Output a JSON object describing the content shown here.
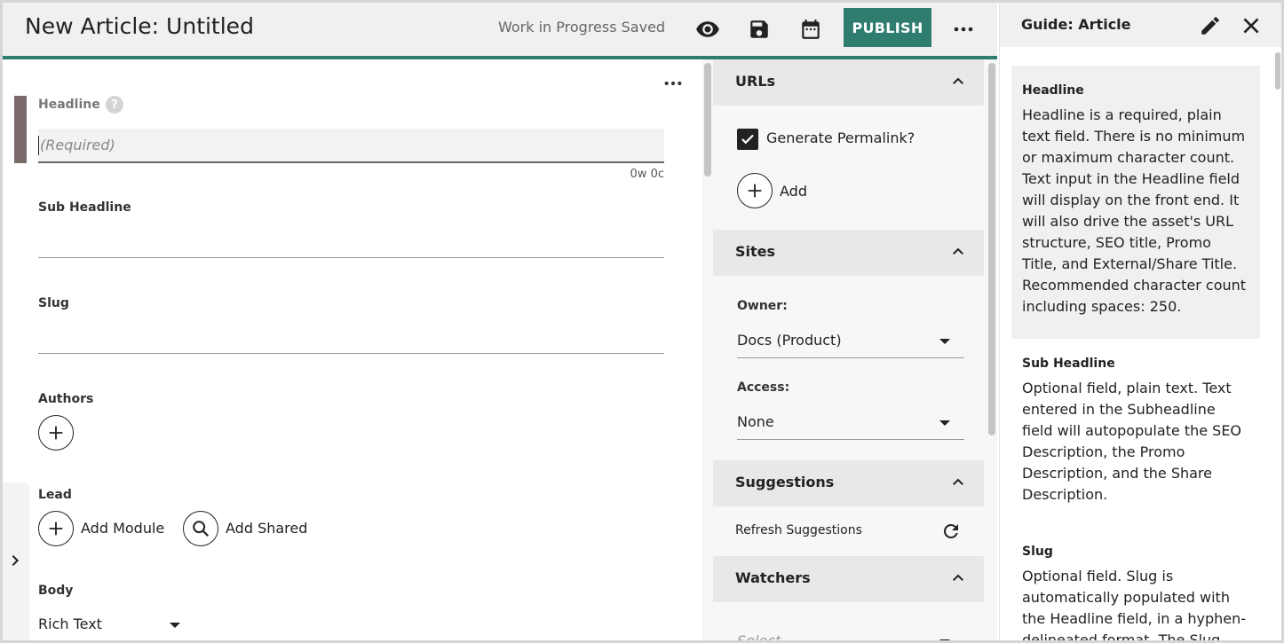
{
  "header": {
    "title": "New Article: Untitled",
    "save_status": "Work in Progress Saved",
    "publish_label": "PUBLISH"
  },
  "editor": {
    "headline": {
      "label": "Headline",
      "help": "?",
      "placeholder": "(Required)",
      "count": "0w 0c"
    },
    "sub_headline": {
      "label": "Sub Headline"
    },
    "slug": {
      "label": "Slug"
    },
    "authors": {
      "label": "Authors"
    },
    "lead": {
      "label": "Lead",
      "add_module_label": "Add Module",
      "add_shared_label": "Add Shared"
    },
    "body": {
      "label": "Body",
      "selected": "Rich Text"
    }
  },
  "panel": {
    "urls": {
      "title": "URLs",
      "generate_permalink_label": "Generate Permalink?",
      "generate_permalink_checked": true,
      "add_label": "Add"
    },
    "sites": {
      "title": "Sites",
      "owner_label": "Owner:",
      "owner_value": "Docs (Product)",
      "access_label": "Access:",
      "access_value": "None"
    },
    "suggestions": {
      "title": "Suggestions",
      "refresh_label": "Refresh Suggestions"
    },
    "watchers": {
      "title": "Watchers",
      "select_placeholder": "Select"
    }
  },
  "guide": {
    "title": "Guide: Article",
    "entries": [
      {
        "heading": "Headline",
        "text": "Headline is a required, plain text field. There is no minimum or maximum character count. Text input in the Headline field will display on the front end. It will also drive the asset's URL structure, SEO title, Promo Title, and External/Share Title. Recommended character count including spaces: 250."
      },
      {
        "heading": "Sub Headline",
        "text": "Optional field, plain text. Text entered in the Subheadline field will autopopulate the SEO Description, the Promo Description, and the Share Description."
      },
      {
        "heading": "Slug",
        "text": "Optional field. Slug is automatically populated with the Headline field, in a hyphen-delineated format. The Slug field"
      }
    ]
  },
  "colors": {
    "accent": "#2e7d6e",
    "focus_bar": "#7a6a6a",
    "header_bg": "#f0f0f0"
  }
}
